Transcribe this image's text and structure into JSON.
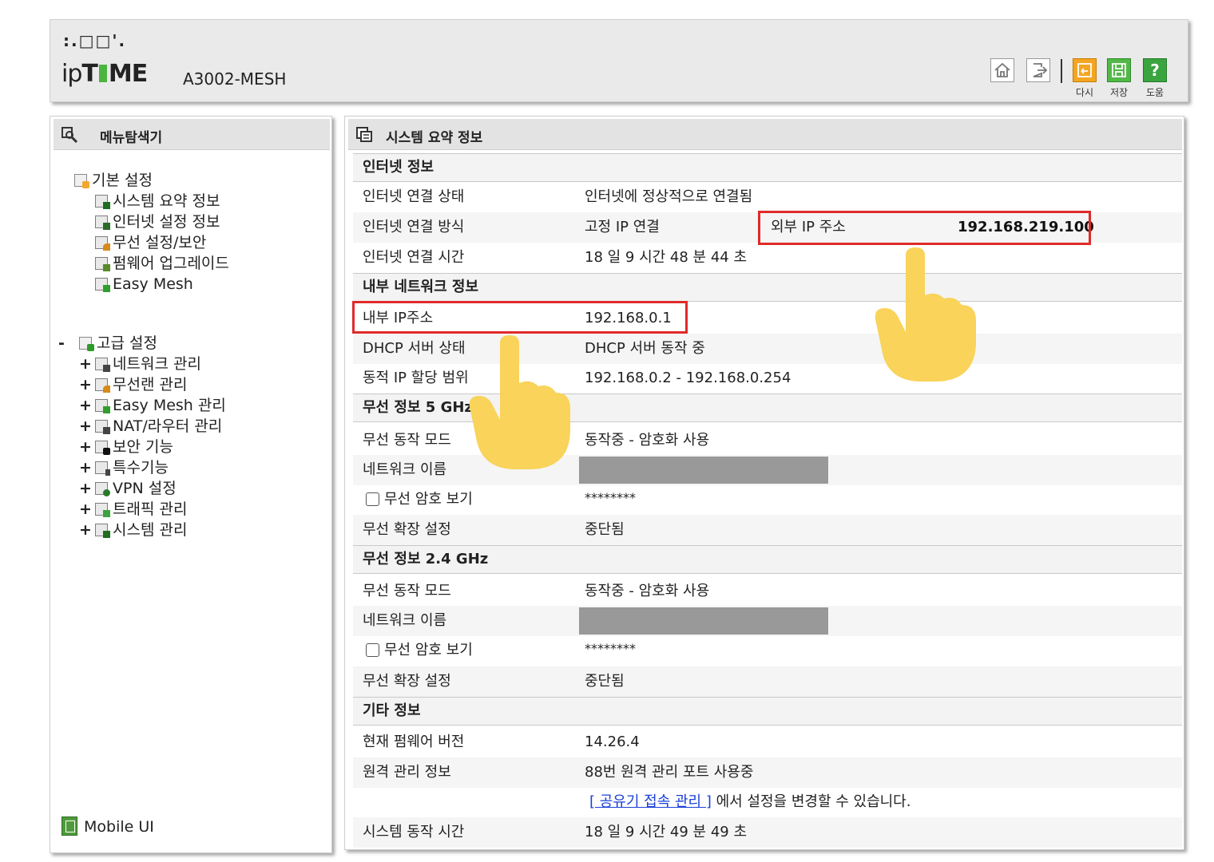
{
  "header": {
    "logo_dots": ":.□□'.",
    "brand_ip": "ip",
    "brand_time_t": "T",
    "brand_time_me": "ME",
    "model": "A3002-MESH",
    "buttons": {
      "refresh_label": "다시",
      "save_label": "저장",
      "help_label": "도움"
    }
  },
  "sidebar": {
    "title": "메뉴탐색기",
    "basic": {
      "label": "기본 설정",
      "items": [
        {
          "label": "시스템 요약 정보",
          "icon": "chart-icon"
        },
        {
          "label": "인터넷 설정 정보",
          "icon": "monitor-icon"
        },
        {
          "label": "무선 설정/보안",
          "icon": "wifi-icon"
        },
        {
          "label": "펌웨어 업그레이드",
          "icon": "upgrade-icon"
        },
        {
          "label": "Easy Mesh",
          "icon": "mesh-icon"
        }
      ]
    },
    "advanced": {
      "toggle": "-",
      "label": "고급 설정",
      "items": [
        {
          "label": "네트워크 관리",
          "icon": "network-icon"
        },
        {
          "label": "무선랜 관리",
          "icon": "wifi-icon"
        },
        {
          "label": "Easy Mesh 관리",
          "icon": "mesh-icon"
        },
        {
          "label": "NAT/라우터 관리",
          "icon": "router-icon"
        },
        {
          "label": "보안 기능",
          "icon": "lock-icon"
        },
        {
          "label": "특수기능",
          "icon": "special-icon"
        },
        {
          "label": "VPN 설정",
          "icon": "vpn-icon"
        },
        {
          "label": "트래픽 관리",
          "icon": "traffic-icon"
        },
        {
          "label": "시스템 관리",
          "icon": "chart-icon"
        }
      ]
    },
    "mobile_ui": "Mobile UI"
  },
  "main": {
    "title": "시스템 요약 정보",
    "internet": {
      "title": "인터넷 정보",
      "status_label": "인터넷 연결 상태",
      "status_value": "인터넷에 정상적으로 연결됨",
      "method_label": "인터넷 연결 방식",
      "method_value": "고정 IP 연결",
      "external_ip_label": "외부 IP 주소",
      "external_ip_value": "192.168.219.100",
      "time_label": "인터넷 연결 시간",
      "time_value": "18 일 9 시간 48 분 44 초"
    },
    "lan": {
      "title": "내부 네트워크 정보",
      "ip_label": "내부 IP주소",
      "ip_value": "192.168.0.1",
      "dhcp_label": "DHCP 서버 상태",
      "dhcp_value": "DHCP 서버 동작 중",
      "range_label": "동적 IP 할당 범위",
      "range_value": "192.168.0.2 -  192.168.0.254"
    },
    "wifi5": {
      "title": "무선 정보 5 GHz",
      "mode_label": "무선 동작 모드",
      "mode_value": "동작중 - 암호화 사용",
      "ssid_label": "네트워크 이름",
      "pw_label": "무선 암호 보기",
      "pw_value": "********",
      "ext_label": "무선 확장 설정",
      "ext_value": "중단됨"
    },
    "wifi24": {
      "title": "무선 정보 2.4 GHz",
      "mode_label": "무선 동작 모드",
      "mode_value": "동작중 - 암호화 사용",
      "ssid_label": "네트워크 이름",
      "pw_label": "무선 암호 보기",
      "pw_value": "********",
      "ext_label": "무선 확장 설정",
      "ext_value": "중단됨"
    },
    "etc": {
      "title": "기타 정보",
      "fw_label": "현재 펌웨어 버전",
      "fw_value": "14.26.4",
      "remote_label": "원격 관리 정보",
      "remote_value": "88번 원격 관리 포트 사용중",
      "remote_link": "[ 공유기 접속 관리 ]",
      "remote_suffix": " 에서 설정을 변경할 수 있습니다.",
      "uptime_label": "시스템 동작 시간",
      "uptime_value": "18 일 9 시간 49 분 49 초"
    }
  },
  "colors": {
    "highlight": "#e02a2a",
    "pointer_hand": "#f9d35a",
    "brand_green": "#4bb33f",
    "link": "#1a3fd8"
  }
}
